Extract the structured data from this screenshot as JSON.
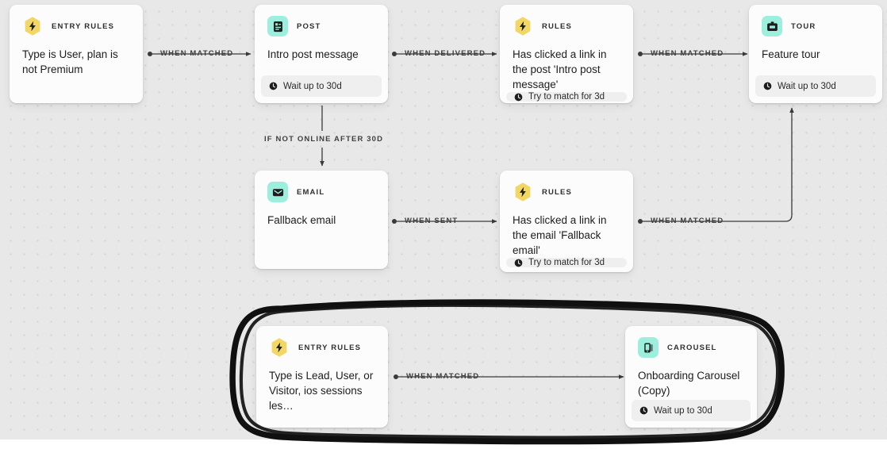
{
  "canvas": {
    "background_color": "#e8e8e8",
    "dot_color": "#d3d3d3",
    "accent_yellow": "#f2d765",
    "accent_mint": "#9ceedd",
    "annotation_color": "#101010"
  },
  "nodes": [
    {
      "id": "entry-rules-top",
      "kind": "ENTRY RULES",
      "icon": "lightning-hexagon-icon",
      "title": "Type is User, plan is not Premium",
      "footer": null
    },
    {
      "id": "post",
      "kind": "POST",
      "icon": "post-icon",
      "title": "Intro post message",
      "footer": "Wait up to 30d"
    },
    {
      "id": "rules-post",
      "kind": "RULES",
      "icon": "lightning-hexagon-icon",
      "title": "Has clicked a link in the post 'Intro post message'",
      "footer": "Try to match for 3d"
    },
    {
      "id": "tour",
      "kind": "TOUR",
      "icon": "tour-icon",
      "title": "Feature tour",
      "footer": "Wait up to 30d"
    },
    {
      "id": "email",
      "kind": "EMAIL",
      "icon": "email-icon",
      "title": "Fallback email",
      "footer": null
    },
    {
      "id": "rules-email",
      "kind": "RULES",
      "icon": "lightning-hexagon-icon",
      "title": "Has clicked a link in the email 'Fallback email'",
      "footer": "Try to match for 3d"
    },
    {
      "id": "entry-rules-bottom",
      "kind": "ENTRY RULES",
      "icon": "lightning-hexagon-icon",
      "title": "Type is Lead, User, or Visitor, ios sessions les…",
      "footer": null
    },
    {
      "id": "carousel",
      "kind": "CAROUSEL",
      "icon": "carousel-icon",
      "title": "Onboarding Carousel (Copy)",
      "footer": "Wait up to 30d"
    }
  ],
  "edges": [
    {
      "id": "entry-to-post",
      "label": "WHEN MATCHED"
    },
    {
      "id": "post-to-rules",
      "label": "WHEN DELIVERED"
    },
    {
      "id": "rules-to-tour",
      "label": "WHEN MATCHED"
    },
    {
      "id": "post-to-email",
      "label": "IF NOT ONLINE AFTER 30D"
    },
    {
      "id": "email-to-rules",
      "label": "WHEN SENT"
    },
    {
      "id": "rulesemail-to-tour",
      "label": "WHEN MATCHED"
    },
    {
      "id": "entrybottom-to-carousel",
      "label": "WHEN MATCHED"
    }
  ]
}
